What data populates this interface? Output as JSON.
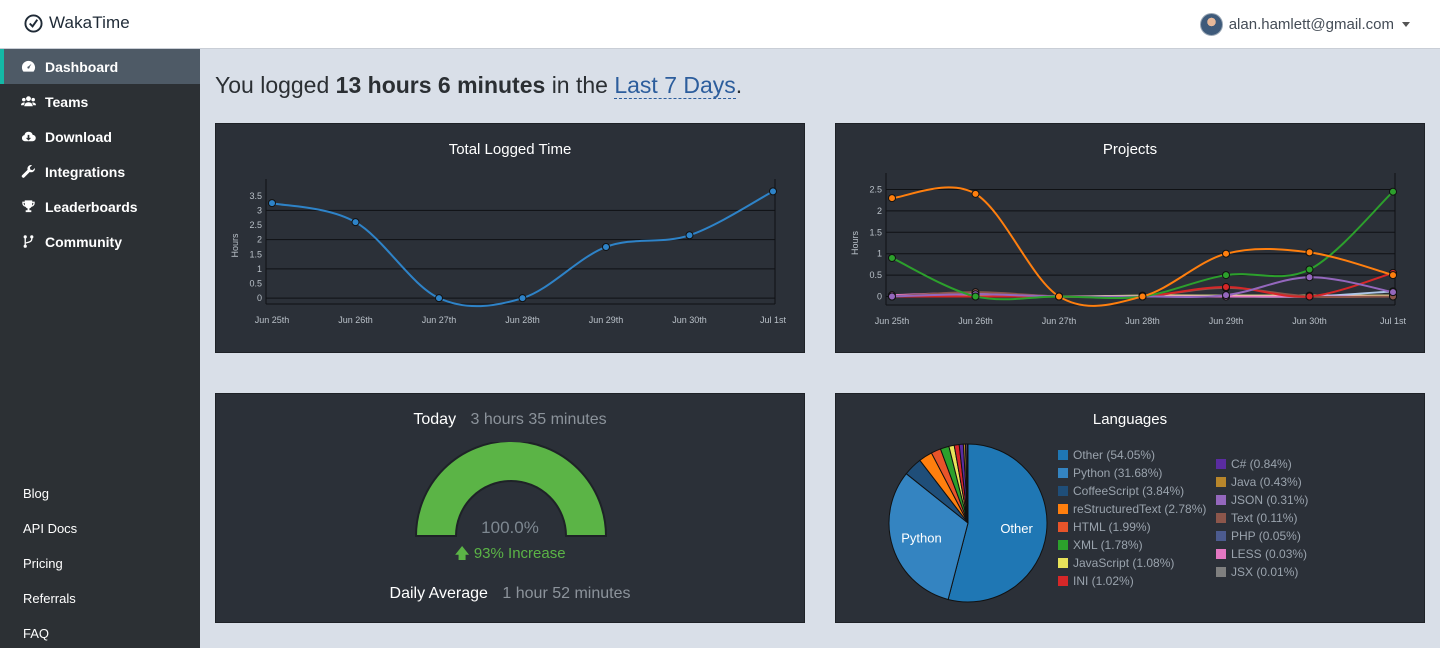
{
  "app": {
    "name": "WakaTime"
  },
  "user": {
    "email": "alan.hamlett@gmail.com"
  },
  "sidebar": {
    "items": [
      {
        "label": "Dashboard",
        "icon": "dashboard-icon",
        "active": true
      },
      {
        "label": "Teams",
        "icon": "users-icon"
      },
      {
        "label": "Download",
        "icon": "cloud-download-icon"
      },
      {
        "label": "Integrations",
        "icon": "wrench-icon"
      },
      {
        "label": "Leaderboards",
        "icon": "trophy-icon"
      },
      {
        "label": "Community",
        "icon": "code-fork-icon"
      }
    ],
    "links": [
      "Blog",
      "API Docs",
      "Pricing",
      "Referrals",
      "FAQ"
    ]
  },
  "headline": {
    "prefix": "You logged",
    "total": "13 hours 6 minutes",
    "middle": "in the",
    "range": "Last 7 Days",
    "suffix": "."
  },
  "panels": {
    "total": {
      "title": "Total Logged Time"
    },
    "projects": {
      "title": "Projects"
    },
    "today": {
      "label": "Today",
      "value": "3 hours 35 minutes",
      "percent": "100.0%",
      "increase": "93% Increase",
      "avg_label": "Daily Average",
      "avg_value": "1 hour 52 minutes"
    },
    "languages": {
      "title": "Languages"
    }
  },
  "colors": {
    "accent": "#14b8a6",
    "line": "#2e83c8",
    "gauge": "#5bb446",
    "link": "#2c5d9c"
  },
  "chart_data": [
    {
      "type": "line",
      "title": "Total Logged Time",
      "ylabel": "Hours",
      "x": [
        "Jun 25th",
        "Jun 26th",
        "Jun 27th",
        "Jun 28th",
        "Jun 29th",
        "Jun 30th",
        "Jul 1st"
      ],
      "yticks": [
        0,
        0.5,
        1,
        1.5,
        2,
        2.5,
        3,
        3.5
      ],
      "ylim": [
        -0.2,
        3.8
      ],
      "series": [
        {
          "values": [
            3.25,
            2.6,
            0.0,
            0.0,
            1.75,
            2.15,
            3.65
          ],
          "color": "#2e83c8"
        }
      ]
    },
    {
      "type": "line",
      "title": "Projects",
      "ylabel": "Hours",
      "x": [
        "Jun 25th",
        "Jun 26th",
        "Jun 27th",
        "Jun 28th",
        "Jun 29th",
        "Jun 30th",
        "Jul 1st"
      ],
      "yticks": [
        0,
        0.5,
        1,
        1.5,
        2,
        2.5
      ],
      "ylim": [
        -0.2,
        2.7
      ],
      "series": [
        {
          "values": [
            2.3,
            2.4,
            0.0,
            0.0,
            1.0,
            1.03,
            0.5
          ],
          "color": "#ff7f0e"
        },
        {
          "values": [
            0.9,
            0.0,
            0.0,
            0.0,
            0.5,
            0.63,
            2.45
          ],
          "color": "#2ca02c"
        },
        {
          "values": [
            0.0,
            0.05,
            0.0,
            0.0,
            0.03,
            0.45,
            0.1
          ],
          "color": "#9467bd"
        },
        {
          "values": [
            0.0,
            0.0,
            0.0,
            0.0,
            0.22,
            0.0,
            0.55
          ],
          "color": "#d62728"
        },
        {
          "values": [
            0.0,
            0.1,
            0.0,
            0.0,
            0.2,
            0.0,
            0.0
          ],
          "color": "#8c564b"
        },
        {
          "values": [
            0.03,
            0.08,
            0.0,
            0.0,
            0.0,
            0.0,
            0.0
          ],
          "color": "#e377c2"
        },
        {
          "values": [
            0.0,
            0.0,
            0.0,
            0.0,
            0.0,
            0.0,
            0.12
          ],
          "color": "#aec7e8"
        },
        {
          "values": [
            0.02,
            0.02,
            0.0,
            0.02,
            0.02,
            0.02,
            0.02
          ],
          "color": "#f4f18e"
        }
      ]
    },
    {
      "type": "pie",
      "title": "Languages",
      "slices": [
        {
          "label": "Other",
          "value": 54.05,
          "display": "Other (54.05%)",
          "color": "#1f77b4",
          "show_label": true
        },
        {
          "label": "Python",
          "value": 31.68,
          "display": "Python (31.68%)",
          "color": "#3484c1",
          "show_label": true
        },
        {
          "label": "CoffeeScript",
          "value": 3.84,
          "display": "CoffeeScript (3.84%)",
          "color": "#1f4e79"
        },
        {
          "label": "reStructuredText",
          "value": 2.78,
          "display": "reStructuredText (2.78%)",
          "color": "#ff7f0e"
        },
        {
          "label": "HTML",
          "value": 1.99,
          "display": "HTML (1.99%)",
          "color": "#e8542a"
        },
        {
          "label": "XML",
          "value": 1.78,
          "display": "XML (1.78%)",
          "color": "#2ca02c"
        },
        {
          "label": "JavaScript",
          "value": 1.08,
          "display": "JavaScript (1.08%)",
          "color": "#e8e35a"
        },
        {
          "label": "INI",
          "value": 1.02,
          "display": "INI (1.02%)",
          "color": "#d62728"
        },
        {
          "label": "C#",
          "value": 0.84,
          "display": "C# (0.84%)",
          "color": "#5a2ca0"
        },
        {
          "label": "Java",
          "value": 0.43,
          "display": "Java (0.43%)",
          "color": "#b8862b"
        },
        {
          "label": "JSON",
          "value": 0.31,
          "display": "JSON (0.31%)",
          "color": "#9467bd"
        },
        {
          "label": "Text",
          "value": 0.11,
          "display": "Text (0.11%)",
          "color": "#8c564b"
        },
        {
          "label": "PHP",
          "value": 0.05,
          "display": "PHP (0.05%)",
          "color": "#4c5b8f"
        },
        {
          "label": "LESS",
          "value": 0.03,
          "display": "LESS (0.03%)",
          "color": "#e377c2"
        },
        {
          "label": "JSX",
          "value": 0.01,
          "display": "JSX (0.01%)",
          "color": "#7f7f7f"
        }
      ]
    }
  ]
}
